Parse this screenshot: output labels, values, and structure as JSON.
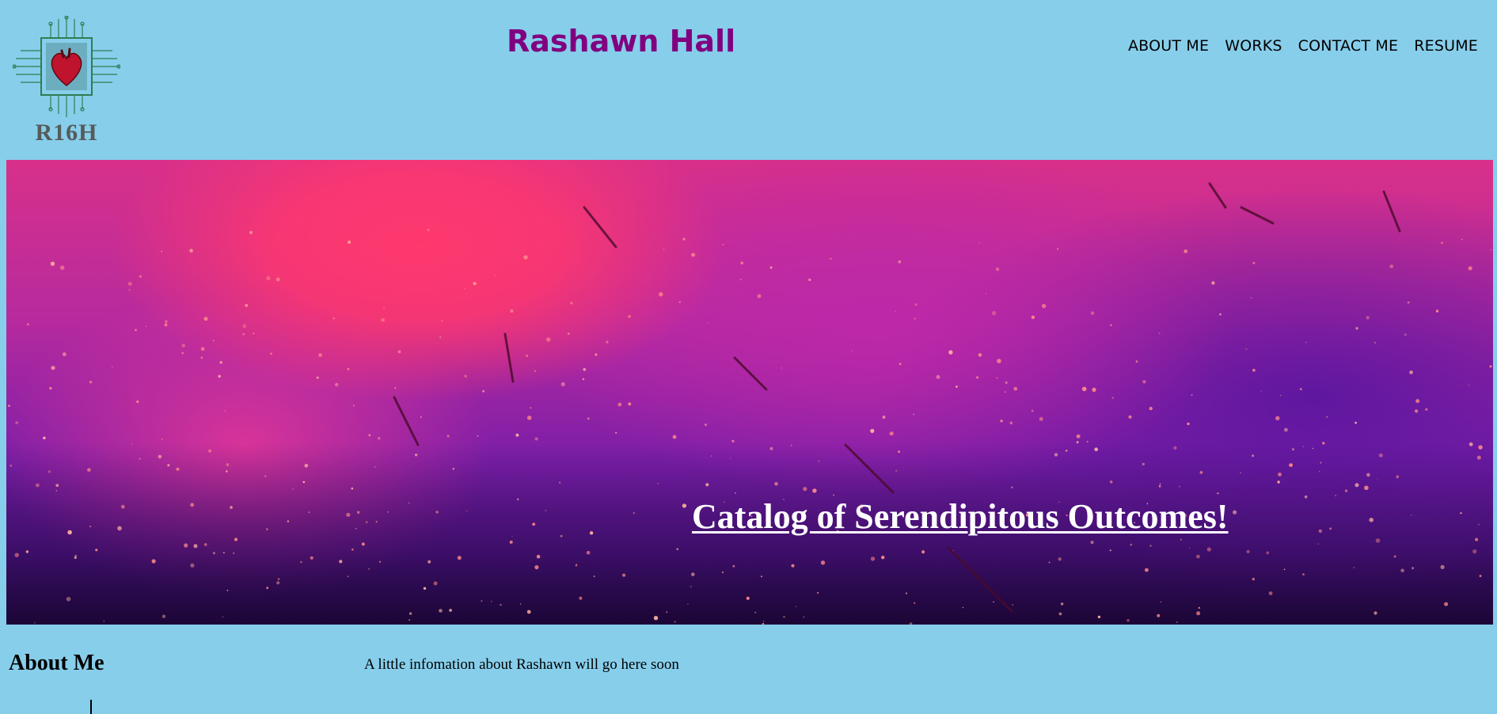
{
  "header": {
    "logo_text": "R16H",
    "site_title": "Rashawn Hall",
    "nav": [
      {
        "label": "ABOUT ME"
      },
      {
        "label": "WORKS"
      },
      {
        "label": "CONTACT ME"
      },
      {
        "label": "RESUME"
      }
    ]
  },
  "hero": {
    "caption": "Catalog of Serendipitous Outcomes!"
  },
  "about": {
    "heading": "About Me",
    "text": "A little infomation about Rashawn will go here soon"
  },
  "colors": {
    "page_background": "#87CEEB",
    "title": "#800080",
    "hero_pink": "#ff386e",
    "hero_purple": "#5c16a0"
  }
}
